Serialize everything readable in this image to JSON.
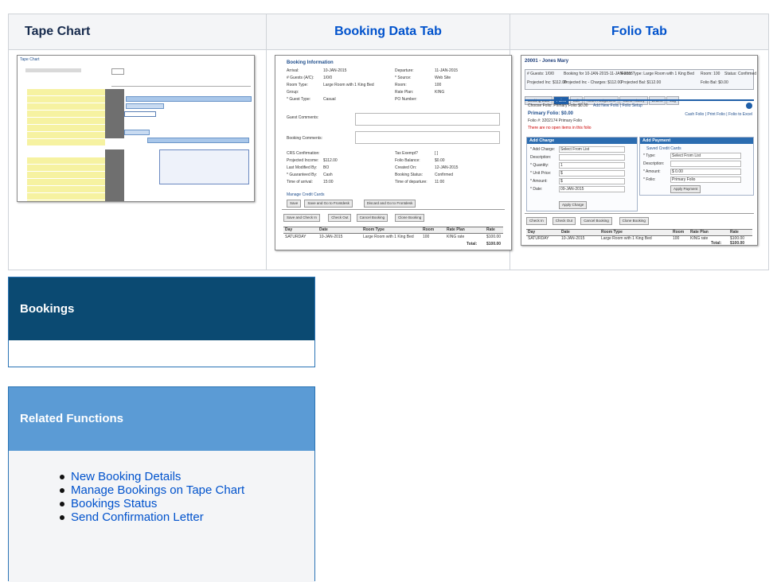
{
  "columns": {
    "tape_chart": "Tape Chart",
    "booking_data": "Booking Data Tab",
    "folio": "Folio Tab"
  },
  "tape_thumb": {
    "title": "Tape Chart",
    "rows": 16
  },
  "booking_thumb": {
    "heading": "Booking Information",
    "fields": [
      {
        "label": "Arrival:",
        "value": "10-JAN-2015"
      },
      {
        "label": "Departure:",
        "value": "11-JAN-2015"
      },
      {
        "label": "# Guests (A/C):",
        "value": "1/0/0"
      },
      {
        "label": "* Source:",
        "value": "Web Site"
      },
      {
        "label": "Room Type:",
        "value": "Large Room with 1 King Bed"
      },
      {
        "label": "Room:",
        "value": "100"
      },
      {
        "label": "Group:",
        "value": ""
      },
      {
        "label": "Rate Plan:",
        "value": "KING"
      },
      {
        "label": "* Guest Type:",
        "value": "Casual"
      },
      {
        "label": "PO Number:",
        "value": ""
      }
    ],
    "comment_labels": [
      "Guest Comments:",
      "Booking Comments:"
    ],
    "lower_fields": [
      {
        "label": "CRS Confirmation:",
        "value": ""
      },
      {
        "label": "Tax Exempt?",
        "value": "[ ]"
      },
      {
        "label": "Projected Income:",
        "value": "$112.00"
      },
      {
        "label": "Folio Balance:",
        "value": "$0.00"
      },
      {
        "label": "Last Modified By:",
        "value": "BO"
      },
      {
        "label": "Created On:",
        "value": "12-JAN-2015"
      },
      {
        "label": "* Guaranteed By:",
        "value": "Cash"
      },
      {
        "label": "Booking Status:",
        "value": "Confirmed"
      },
      {
        "label": "Time of arrival:",
        "value": "15:00"
      },
      {
        "label": "Time of departure:",
        "value": "11:00"
      }
    ],
    "manage_link": "Manage Credit Cards",
    "buttons": [
      "Save",
      "Save and Go to Frontdesk",
      "Discard and Go to Frontdesk"
    ],
    "action_buttons": [
      "Save and Check In",
      "Check Out",
      "Cancel Booking",
      "Clone Booking"
    ],
    "table_headers": [
      "Day",
      "Date",
      "Room Type",
      "Room",
      "Rate Plan",
      "Rate"
    ],
    "table_row": [
      "SATURDAY",
      "10-JAN-2015",
      "Large Room with 1 King Bed",
      "100",
      "KING rate",
      "$100.00"
    ],
    "total_label": "Total:",
    "total_value": "$100.00"
  },
  "folio_thumb": {
    "header": "20001 - Jones Mary",
    "info": [
      "# Guests: 1/0/0",
      "Booking for 10-JAN-2015-11-JAN-2015",
      "Room Type: Large Room with 1 King Bed",
      "Room: 100",
      "Status: Confirmed",
      "Projected Inc: $112.00",
      "Projected Inc - Charges: $112.00",
      "Projected Bal: $112.00",
      "Folio Bal: $0.00"
    ],
    "tabs": [
      "Booking Data",
      "Folios",
      "Edit",
      "Room Assignment",
      "Guest History",
      "Letters",
      "Log"
    ],
    "choose_folio": "Choose Folio:  Primary Folio $0.00",
    "folio_links": "Add New Folio | Folio Setup",
    "primary_folio": "Primary Folio: $0.00",
    "folio_number": "Folio #: 3202174 Primary Folio",
    "right_links": "Cash Folio | Print Folio | Folio to Excel",
    "no_items": "There are no open items in this folio",
    "add_charge_title": "Add Charge",
    "add_payment_title": "Add Payment",
    "charge_fields": [
      "* Add Charge:",
      "Description:",
      "* Quantity:",
      "* Unit Price:",
      "* Amount:",
      "* Date:"
    ],
    "charge_values": [
      "Select From List",
      "",
      "1",
      "$",
      "$",
      "09-JAN-2015"
    ],
    "apply_charge": "Apply Charge",
    "payment_link": "Saved Credit Cards",
    "payment_fields": [
      "* Type:",
      "Description:",
      "* Amount:",
      "* Folio:"
    ],
    "payment_values": [
      "Select From List",
      "",
      "$ 0.00",
      "Primary Folio"
    ],
    "apply_payment": "Apply Payment",
    "action_buttons": [
      "Check In",
      "Check Out",
      "Cancel Booking",
      "Clone Booking"
    ],
    "table_headers": [
      "Day",
      "Date",
      "Room Type",
      "Room",
      "Rate Plan",
      "Rate"
    ],
    "table_row": [
      "SATURDAY",
      "10-JAN-2015",
      "Large Room with 1 King Bed",
      "100",
      "KING rate",
      "$100.00"
    ],
    "total_label": "Total:",
    "total_value": "$100.00"
  },
  "bookings_panel": {
    "title": "Bookings"
  },
  "related_panel": {
    "title": "Related Functions",
    "links": [
      "New Booking Details",
      " Manage Bookings on Tape Chart",
      "Bookings Status",
      "Send Confirmation Letter"
    ]
  }
}
